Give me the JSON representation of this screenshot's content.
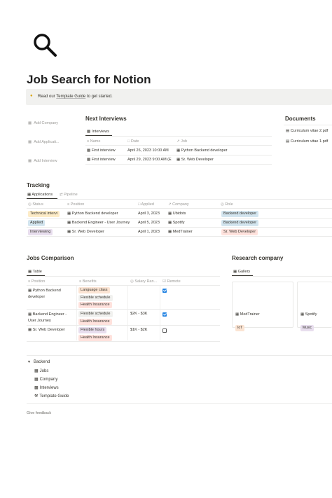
{
  "page": {
    "title": "Job Search for Notion",
    "callout": {
      "prefix": "Read our ",
      "link": "Template Guide",
      "suffix": " to get started."
    }
  },
  "quick_actions": [
    "Add Company",
    "Add Applicati...",
    "Add Interview"
  ],
  "next_interviews": {
    "title": "Next Interviews",
    "tab": "Interviews",
    "columns": [
      "Name",
      "Date",
      "Job"
    ],
    "rows": [
      {
        "name": "First interview",
        "date": "April 26, 2023 10:00 AM",
        "job": "Python Backend developer"
      },
      {
        "name": "First interview",
        "date": "April 29, 2023 9:00 AM (E",
        "job": "Sr. Web Developer"
      }
    ]
  },
  "documents": {
    "title": "Documents",
    "items": [
      "Curriculum vitae 2.pdf",
      "Curriculum vitae 1.pdf"
    ]
  },
  "tracking": {
    "title": "Tracking",
    "tabs": [
      "Applications",
      "Pipeline"
    ],
    "columns": [
      "Status",
      "Position",
      "Applied",
      "Company",
      "Role"
    ],
    "rows": [
      {
        "status": "Technical intervi",
        "position": "Python Backend developer",
        "applied": "April 3, 2023",
        "company": "Ubidots",
        "role": "Backend developer"
      },
      {
        "status": "Applied",
        "position": "Backend Engineer - User Journey",
        "applied": "April 5, 2023",
        "company": "Spotify",
        "role": "Backend developer"
      },
      {
        "status": "Interviewing",
        "position": "Sr. Web Developer",
        "applied": "April 1, 2023",
        "company": "MedTrainer",
        "role": "Sr. Web Developer"
      }
    ]
  },
  "jobs_comparison": {
    "title": "Jobs Comparison",
    "tab": "Table",
    "columns": [
      "Position",
      "Benefits",
      "Salary Ran...",
      "Remote"
    ],
    "rows": [
      {
        "position_1": "Python Backend",
        "position_2": "developer",
        "benefits": [
          "Language class",
          "Flexible schedule",
          "Health Insurance"
        ],
        "salary": "",
        "remote": true
      },
      {
        "position_1": "Backend Engineer -",
        "position_2": "User Journey",
        "benefits": [
          "Flexible schedule",
          "Health Insurance"
        ],
        "salary": "$2K - $3K",
        "remote": true
      },
      {
        "position_1": "Sr. Web Developer",
        "position_2": "",
        "benefits": [
          "Flexible hours",
          "Health Insurance"
        ],
        "salary": "$1K - $2K",
        "remote": false
      }
    ]
  },
  "research": {
    "title": "Research company",
    "tab": "Gallery",
    "cards": [
      {
        "name": "MedTrainer",
        "tag": "IoT"
      },
      {
        "name": "Spotify",
        "tag": "Music"
      }
    ]
  },
  "backend": {
    "toggle": "Backend",
    "links": [
      "Jobs",
      "Company",
      "Interviews",
      "Template Guide"
    ]
  },
  "footer": {
    "feedback": "Give feedback"
  },
  "colors": {
    "tag_orange": "#fbe4d3",
    "tag_blue": "#d3e5ef",
    "tag_purple": "#e8deee",
    "tag_red": "#ffe2dd",
    "tag_yellow": "#fdecc8",
    "checkbox": "#2383e2"
  }
}
